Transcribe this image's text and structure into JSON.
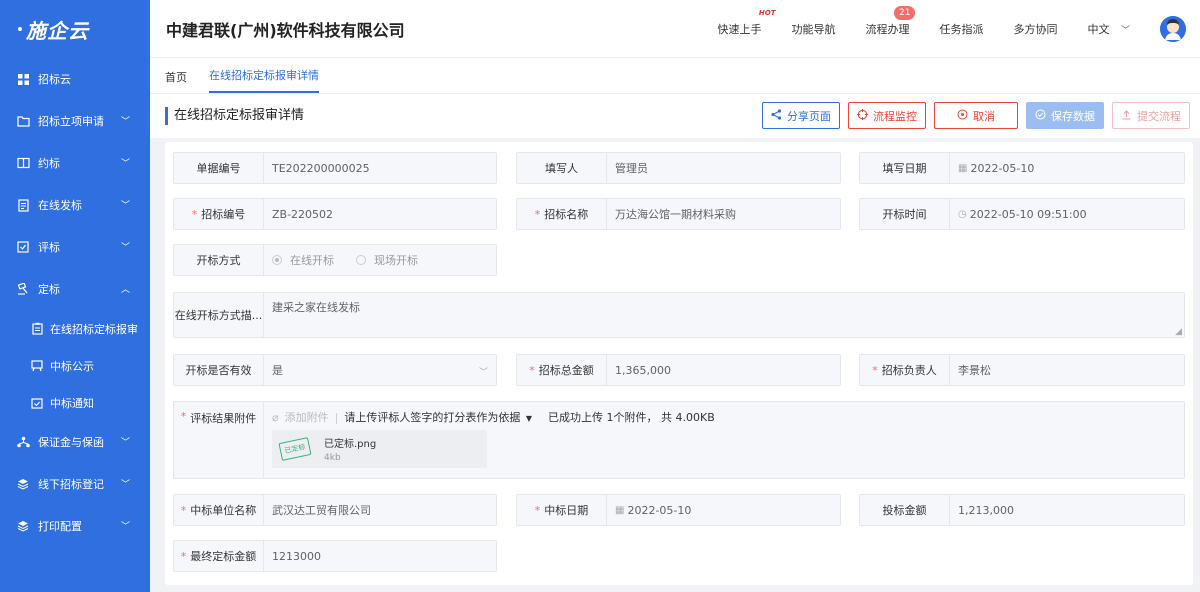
{
  "sidebar": {
    "logo": "施企云",
    "items": [
      {
        "label": "招标云"
      },
      {
        "label": "招标立项申请"
      },
      {
        "label": "约标"
      },
      {
        "label": "在线发标"
      },
      {
        "label": "评标"
      },
      {
        "label": "定标"
      },
      {
        "label": "保证金与保函"
      },
      {
        "label": "线下招标登记"
      },
      {
        "label": "打印配置"
      }
    ],
    "sub_items": [
      {
        "label": "在线招标定标报审"
      },
      {
        "label": "中标公示"
      },
      {
        "label": "中标通知"
      }
    ]
  },
  "header": {
    "company": "中建君联(广州)软件科技有限公司",
    "nav": [
      {
        "label": "快速上手"
      },
      {
        "label": "功能导航"
      },
      {
        "label": "流程办理"
      },
      {
        "label": "任务指派"
      },
      {
        "label": "多方协同"
      },
      {
        "label": "中文"
      }
    ],
    "hot_label": "HOT",
    "badge_count": "21"
  },
  "tabs": [
    {
      "label": "首页"
    },
    {
      "label": "在线招标定标报审详情"
    }
  ],
  "page": {
    "title": "在线招标定标报审详情",
    "actions": {
      "share": "分享页面",
      "monitor": "流程监控",
      "cancel": "取消",
      "save": "保存数据",
      "submit": "提交流程"
    }
  },
  "form": {
    "doc_no_label": "单据编号",
    "doc_no": "TE202200000025",
    "author_label": "填写人",
    "author": "管理员",
    "date_label": "填写日期",
    "date": "2022-05-10",
    "bid_no_label": "招标编号",
    "bid_no": "ZB-220502",
    "bid_name_label": "招标名称",
    "bid_name": "万达海公馆一期材料采购",
    "open_time_label": "开标时间",
    "open_time": "2022-05-10 09:51:00",
    "open_mode_label": "开标方式",
    "open_mode_online": "在线开标",
    "open_mode_onsite": "现场开标",
    "online_desc_label": "在线开标方式描...",
    "online_desc": "建采之家在线发标",
    "valid_label": "开标是否有效",
    "valid": "是",
    "total_amount_label": "招标总金额",
    "total_amount": "1,365,000",
    "owner_label": "招标负责人",
    "owner": "李景松",
    "attach_label": "评标结果附件",
    "attach_add": "添加附件",
    "attach_hint": "请上传评标人签字的打分表作为依据",
    "attach_status": "已成功上传 1个附件， 共 4.00KB",
    "file_name": "已定标.png",
    "file_size": "4kb",
    "stamp_text": "已定标",
    "winner_label": "中标单位名称",
    "winner": "武汉达工贸有限公司",
    "win_date_label": "中标日期",
    "win_date": "2022-05-10",
    "bid_amount_label": "投标金额",
    "bid_amount": "1,213,000",
    "final_amount_label": "最终定标金额",
    "final_amount": "1213000"
  }
}
